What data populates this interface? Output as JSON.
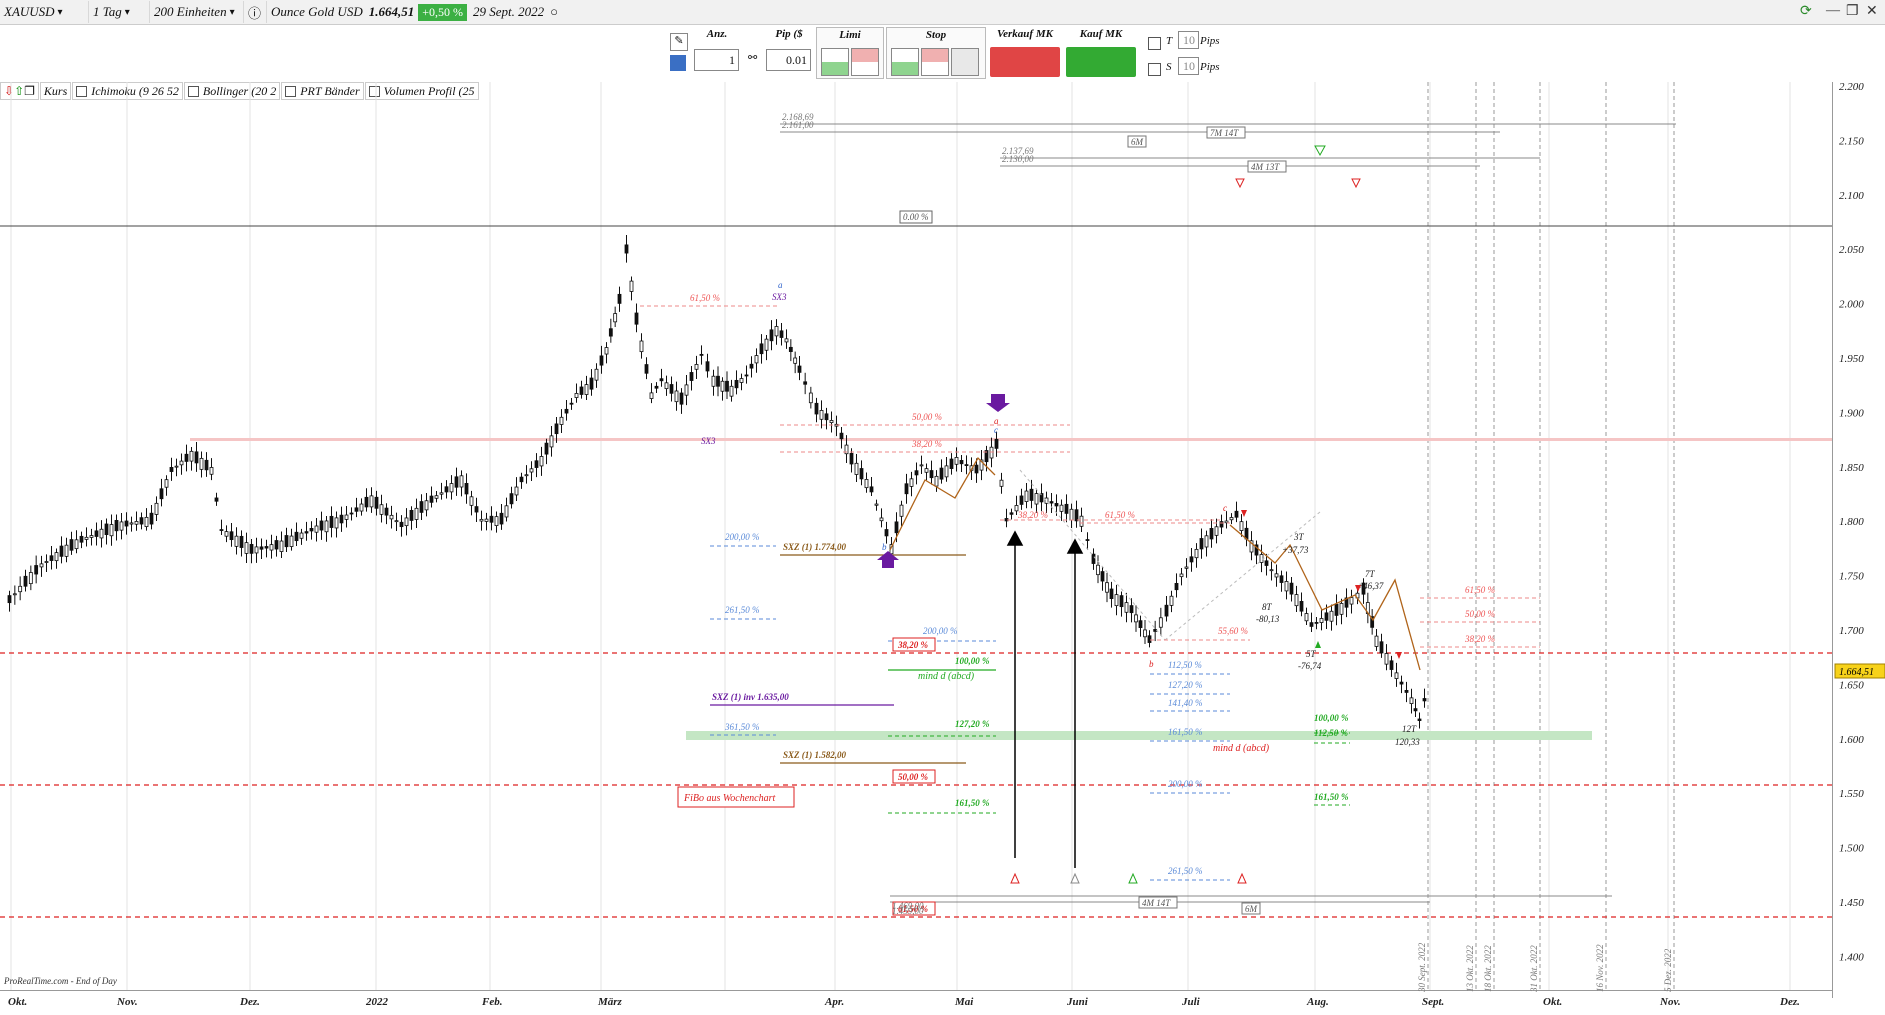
{
  "toolbar": {
    "symbol": "XAUUSD",
    "timeframe": "1 Tag",
    "units": "200 Einheiten",
    "instrument": "Ounce Gold USD",
    "last_price": "1.664,51",
    "change": "+0,50 %",
    "date": "29 Sept. 2022"
  },
  "order": {
    "qty_label": "Anz.",
    "qty_value": "1",
    "pip_label": "Pip ($",
    "pip_value": "0.01",
    "limit_label": "Limi",
    "stop_label": "Stop",
    "sell_label": "Verkauf MK",
    "buy_label": "Kauf MK",
    "t_label": "T",
    "s_label": "S",
    "t_value": "10",
    "s_value": "10",
    "pips_label": "Pips"
  },
  "indicators": [
    "Kurs",
    "Ichimoku (9 26 52",
    "Bollinger (20 2",
    "PRT Bänder",
    "Volumen Profil (25"
  ],
  "yaxis": {
    "ticks": [
      "2.200",
      "2.150",
      "2.100",
      "2.050",
      "2.000",
      "1.950",
      "1.900",
      "1.850",
      "1.800",
      "1.750",
      "1.700",
      "1.650",
      "1.600",
      "1.550",
      "1.500",
      "1.450",
      "1.400"
    ],
    "current": "1.664,51"
  },
  "xaxis": {
    "months": [
      "Okt.",
      "Nov.",
      "Dez.",
      "2022",
      "Feb.",
      "März",
      "Apr.",
      "Mai",
      "Juni",
      "Juli",
      "Aug.",
      "Sept.",
      "Okt.",
      "Nov.",
      "Dez.",
      "2023"
    ]
  },
  "future_dates": [
    "30 Sept. 2022",
    "13 Okt. 2022",
    "18 Okt. 2022",
    "31 Okt. 2022",
    "16 Nov. 2022",
    "5 Dez. 2022"
  ],
  "annotations": {
    "fib_top": "0.00 %",
    "lvl_2168": "2.168,69",
    "lvl_2161": "2.161,00",
    "lvl_2137": "2.137,69",
    "lvl_2130": "2.130,00",
    "tag_6m": "6M",
    "tag_7m14t": "7M 14T",
    "tag_4m13t": "4M 13T",
    "fib_6150_a": "61,50 %",
    "fib_50_a": "50,00 %",
    "fib_3820_a": "38,20 %",
    "fib_3820_b": "38,20 %",
    "fib_6150_b": "61,50 %",
    "fib_5560": "55,60 %",
    "fib_6150_c": "61,50 %",
    "fib_50_c": "50,00 %",
    "fib_3820_c": "38,20 %",
    "ext_200": "200,00 %",
    "ext_2615": "261,50 %",
    "ext_3615": "361,50 %",
    "sxz_1774": "SXZ (1) 1.774,00",
    "sxz_inv": "SXZ (1) inv 1.635,00",
    "sxz_1582": "SXZ (1) 1.582,00",
    "box_3820": "38,20 %",
    "box_50": "50,00 %",
    "box_6150": "61,50 %",
    "fibo_week": "FiBo aus Wochenchart",
    "g_200": "200,00 %",
    "g_100": "100,00 %",
    "mind_d": "mind d (abcd)",
    "g_1272": "127,20 %",
    "g_1615": "161,50 %",
    "b_1125": "112,50 %",
    "b_1272": "127,20 %",
    "b_1414": "141,40 %",
    "b_1615": "161,50 %",
    "b_200": "200,00 %",
    "b_2615": "261,50 %",
    "r_100": "100,00 %",
    "r_1125": "112,50 %",
    "r_1615": "161,50 %",
    "mind_d2": "mind d (abcd)",
    "low_1": "1.469,00",
    "low_2": "1.459,00",
    "tag_4m14t": "4M 14T",
    "tag_6m_b": "6M",
    "sx3_a": "SX3",
    "sx3_b": "SX3",
    "wave_a": "a",
    "wave_b": "b",
    "wave_c": "c",
    "wave_b2": "b",
    "wave_c2": "c",
    "t3": "3T",
    "t3_val": "+37,73",
    "t8": "8T",
    "t8_val": "-80,13",
    "t7": "7T",
    "t7_val": "+46,37",
    "t5": "5T",
    "t5_val": "-76,74",
    "t12": "12T",
    "t12_val": "120,33"
  },
  "footer": "ProRealTime.com - End of Day"
}
